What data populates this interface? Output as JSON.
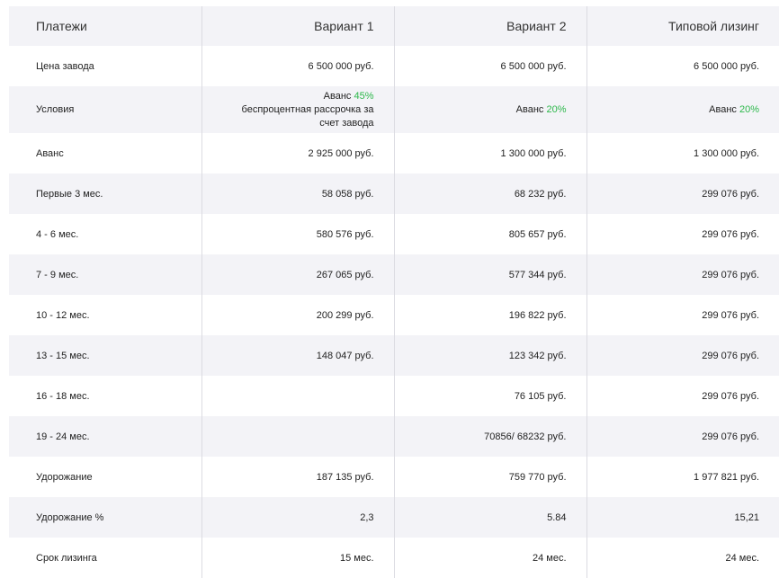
{
  "header": [
    "Платежи",
    "Вариант 1",
    "Вариант 2",
    "Типовой лизинг"
  ],
  "rows": [
    {
      "label": "Цена завода",
      "v1": "6 500 000 руб.",
      "v2": "6 500 000 руб.",
      "v3": "6 500 000 руб."
    },
    {
      "label": "Условия",
      "v1_prefix": "Аванс ",
      "v1_pct": "45%",
      "v1_line2": "беспроцентная рассрочка за",
      "v1_line3": "счет завода",
      "v2_prefix": "Аванс ",
      "v2_pct": "20%",
      "v3_prefix": "Аванс ",
      "v3_pct": "20%"
    },
    {
      "label": "Аванс",
      "v1": "2 925 000 руб.",
      "v2": "1 300 000 руб.",
      "v3": "1 300 000 руб."
    },
    {
      "label": "Первые 3 мес.",
      "v1": "58 058 руб.",
      "v2": "68 232 руб.",
      "v3": "299 076 руб."
    },
    {
      "label": "4 - 6 мес.",
      "v1": "580 576 руб.",
      "v2": "805 657 руб.",
      "v3": "299 076 руб."
    },
    {
      "label": "7 - 9 мес.",
      "v1": "267 065 руб.",
      "v2": "577 344 руб.",
      "v3": "299 076 руб."
    },
    {
      "label": "10 - 12 мес.",
      "v1": "200 299 руб.",
      "v2": "196 822 руб.",
      "v3": "299 076 руб."
    },
    {
      "label": "13 - 15 мес.",
      "v1": "148 047 руб.",
      "v2": "123 342 руб.",
      "v3": "299 076 руб."
    },
    {
      "label": "16 - 18 мес.",
      "v1": "",
      "v2": "76 105 руб.",
      "v3": "299 076 руб."
    },
    {
      "label": "19 - 24 мес.",
      "v1": "",
      "v2": "70856/ 68232 руб.",
      "v3": "299 076 руб."
    },
    {
      "label": "Удорожание",
      "v1": "187 135 руб.",
      "v2": "759 770 руб.",
      "v3": "1 977 821 руб."
    },
    {
      "label": "Удорожание %",
      "v1": "2,3",
      "v2": "5.84",
      "v3": "15,21"
    },
    {
      "label": "Срок лизинга",
      "v1": "15 мес.",
      "v2": "24 мес.",
      "v3": "24 мес."
    }
  ],
  "colors": {
    "header_bg": "#f3f3f7",
    "stripe_bg": "#f3f3f7",
    "accent_green": "#2db84b",
    "divider": "#dcdce2"
  }
}
